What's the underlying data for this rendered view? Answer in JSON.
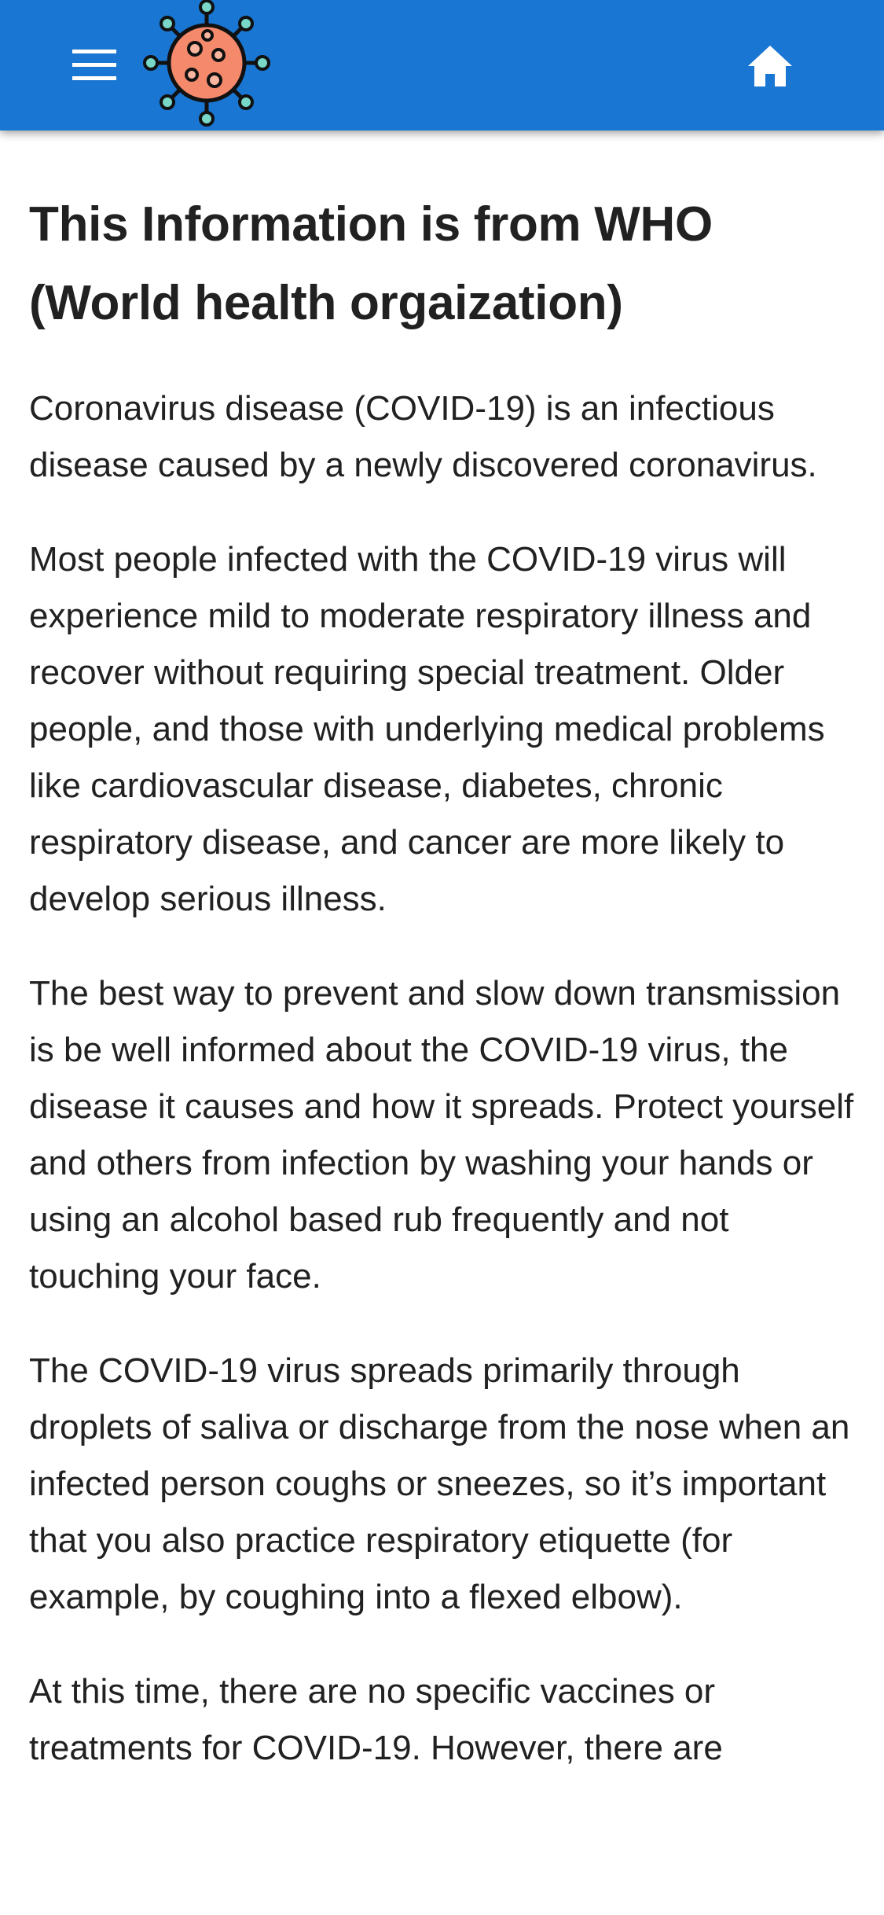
{
  "app_bar": {
    "background_color": "#1976d2",
    "menu_icon": "hamburger-menu-icon",
    "logo_icon": "coronavirus-logo-icon",
    "home_icon": "home-icon",
    "logo_colors": {
      "body": "#f4896b",
      "outline": "#111111",
      "spikes": "#78d7c7"
    }
  },
  "main": {
    "title": "This Information is from WHO (World health orgaization)",
    "paragraphs": [
      "Coronavirus disease (COVID-19) is an infectious disease caused by a newly discovered coronavirus.",
      "Most people infected with the COVID-19 virus will experience mild to moderate respiratory illness and recover without requiring special treatment. Older people, and those with underlying medical problems like cardiovascular disease, diabetes, chronic respiratory disease, and cancer are more likely to develop serious illness.",
      "The best way to prevent and slow down transmission is be well informed about the COVID-19 virus, the disease it causes and how it spreads. Protect yourself and others from infection by washing your hands or using an alcohol based rub frequently and not touching your face.",
      "The COVID-19 virus spreads primarily through droplets of saliva or discharge from the nose when an infected person coughs or sneezes, so it’s important that you also practice respiratory etiquette (for example, by coughing into a flexed elbow).",
      "At this time, there are no specific vaccines or treatments for COVID-19. However, there are"
    ]
  }
}
